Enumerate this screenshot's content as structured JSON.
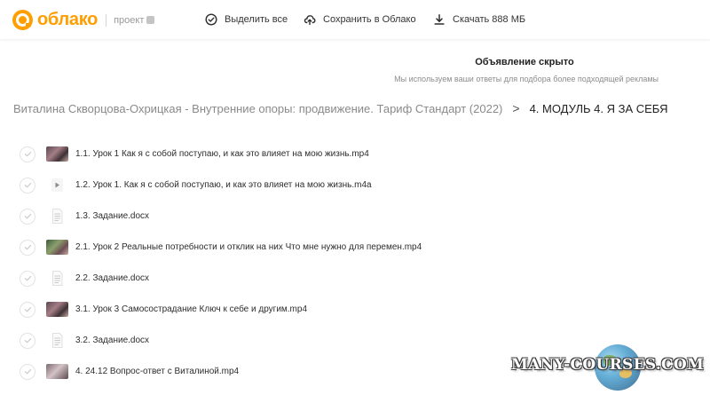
{
  "header": {
    "logo_text": "облако",
    "project_label": "проект",
    "select_all": "Выделить все",
    "save_to_cloud": "Сохранить в Облако",
    "download": "Скачать 888 МБ"
  },
  "ad": {
    "title": "Объявление скрыто",
    "subtitle": "Мы используем ваши ответы для подбора более подходящей рекламы"
  },
  "breadcrumb": {
    "parent": "Виталина Скворцова-Охрицкая - Внутренние опоры: продвижение. Тариф Стандарт (2022)",
    "separator": ">",
    "current": "4. МОДУЛЬ 4. Я ЗА СЕБЯ"
  },
  "files": [
    {
      "name": "1.1. Урок 1 Как я с собой поступаю, и как это влияет на мою жизнь.mp4",
      "type": "video"
    },
    {
      "name": "1.2. Урок 1. Как я с собой поступаю, и как это влияет на мою жизнь.m4a",
      "type": "audio"
    },
    {
      "name": "1.3. Задание.docx",
      "type": "document"
    },
    {
      "name": "2.1. Урок 2 Реальные потребности и отклик на них Что мне нужно для перемен.mp4",
      "type": "video"
    },
    {
      "name": "2.2. Задание.docx",
      "type": "document"
    },
    {
      "name": "3.1. Урок 3 Самосострадание Ключ к себе и другим.mp4",
      "type": "video"
    },
    {
      "name": "3.2. Задание.docx",
      "type": "document"
    },
    {
      "name": "4. 24.12 Вопрос-ответ с Виталиной.mp4",
      "type": "video"
    }
  ],
  "watermark": {
    "text": "MANY-COURSES.COM"
  },
  "colors": {
    "brand": "#ff9e00",
    "text": "#2c2d2e",
    "muted": "#8a8a8a"
  }
}
